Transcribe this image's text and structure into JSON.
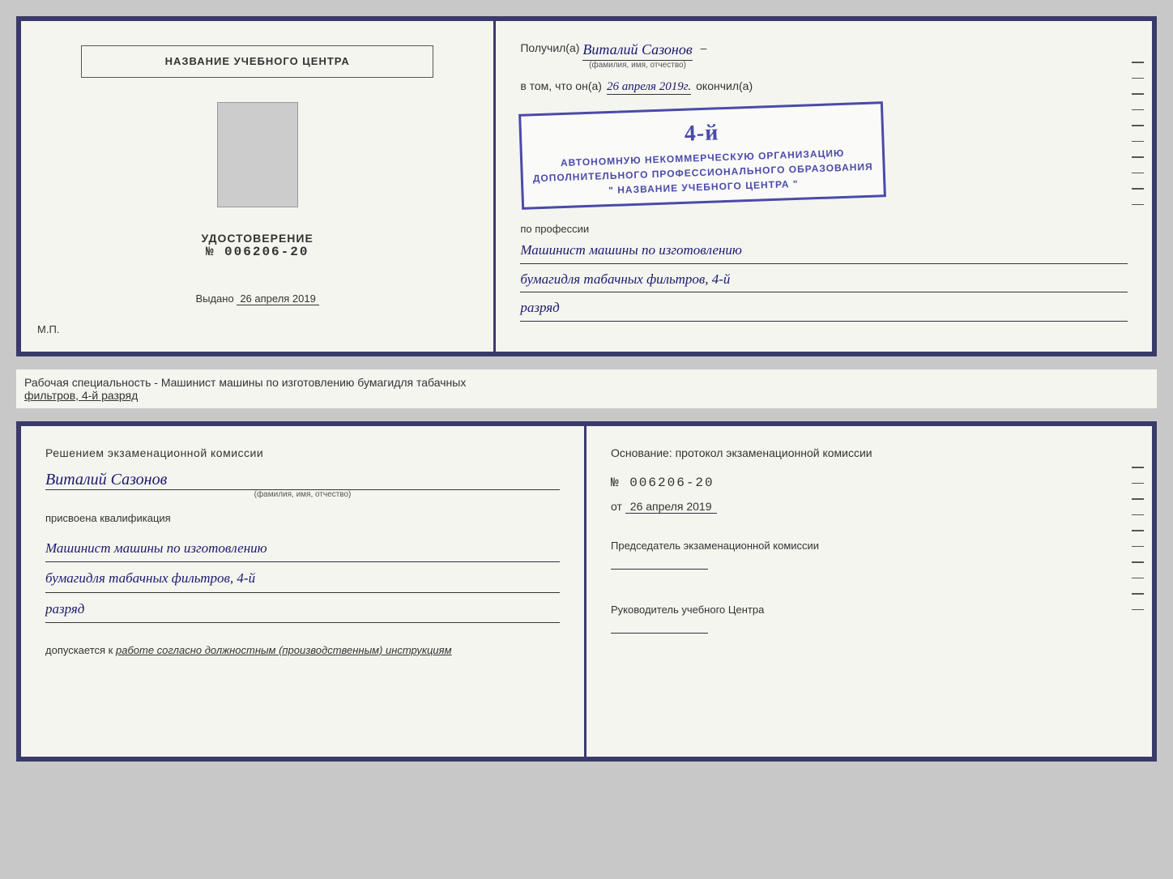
{
  "page": {
    "background_color": "#c8c8c8"
  },
  "top_cert": {
    "left": {
      "title": "НАЗВАНИЕ УЧЕБНОГО ЦЕНТРА",
      "udostoverenie_label": "УДОСТОВЕРЕНИЕ",
      "number_prefix": "№ ",
      "number": "006206-20",
      "vydano_label": "Выдано",
      "vydano_date": "26 апреля 2019",
      "mp_label": "М.П."
    },
    "right": {
      "poluchil_label": "Получил(а)",
      "poluchil_name": "Виталий Сазонов",
      "fio_sub": "(фамилия, имя, отчество)",
      "dash": "–",
      "vtom_label": "в том, что он(а)",
      "vtom_date": "26 апреля 2019г.",
      "okonchil_label": "окончил(а)",
      "stamp_line1": "АВТОНОМНУЮ НЕКОММЕРЧЕСКУЮ ОРГАНИЗАЦИЮ",
      "stamp_line2": "ДОПОЛНИТЕЛЬНОГО ПРОФЕССИОНАЛЬНОГО ОБРАЗОВАНИЯ",
      "stamp_line3": "\" НАЗВАНИЕ УЧЕБНОГО ЦЕНТРА \"",
      "stamp_number": "4-й",
      "po_professii_label": "по профессии",
      "profession_line1": "Машинист машины по изготовлению",
      "profession_line2": "бумагидля табачных фильтров, 4-й",
      "profession_line3": "разряд"
    }
  },
  "info_line": {
    "label": "Рабочая специальность - Машинист машины по изготовлению бумагидля табачных",
    "underlined": "фильтров, 4-й разряд"
  },
  "bottom_cert": {
    "left": {
      "resheniem_label": "Решением экзаменационной комиссии",
      "name_handwritten": "Виталий Сазонов",
      "name_sub": "(фамилия, имя, отчество)",
      "prisvoena_label": "присвоена квалификация",
      "qual_line1": "Машинист машины по изготовлению",
      "qual_line2": "бумагидля табачных фильтров, 4-й",
      "qual_line3": "разряд",
      "dopusk_prefix": "допускается к",
      "dopusk_text": "работе согласно должностным (производственным) инструкциям"
    },
    "right": {
      "osnovaniye_label": "Основание: протокол экзаменационной комиссии",
      "number_prefix": "№ ",
      "number": "006206-20",
      "ot_prefix": "от",
      "ot_date": "26 апреля 2019",
      "predsedatel_label": "Председатель экзаменационной комиссии",
      "rukovoditel_label": "Руководитель учебного Центра"
    }
  }
}
